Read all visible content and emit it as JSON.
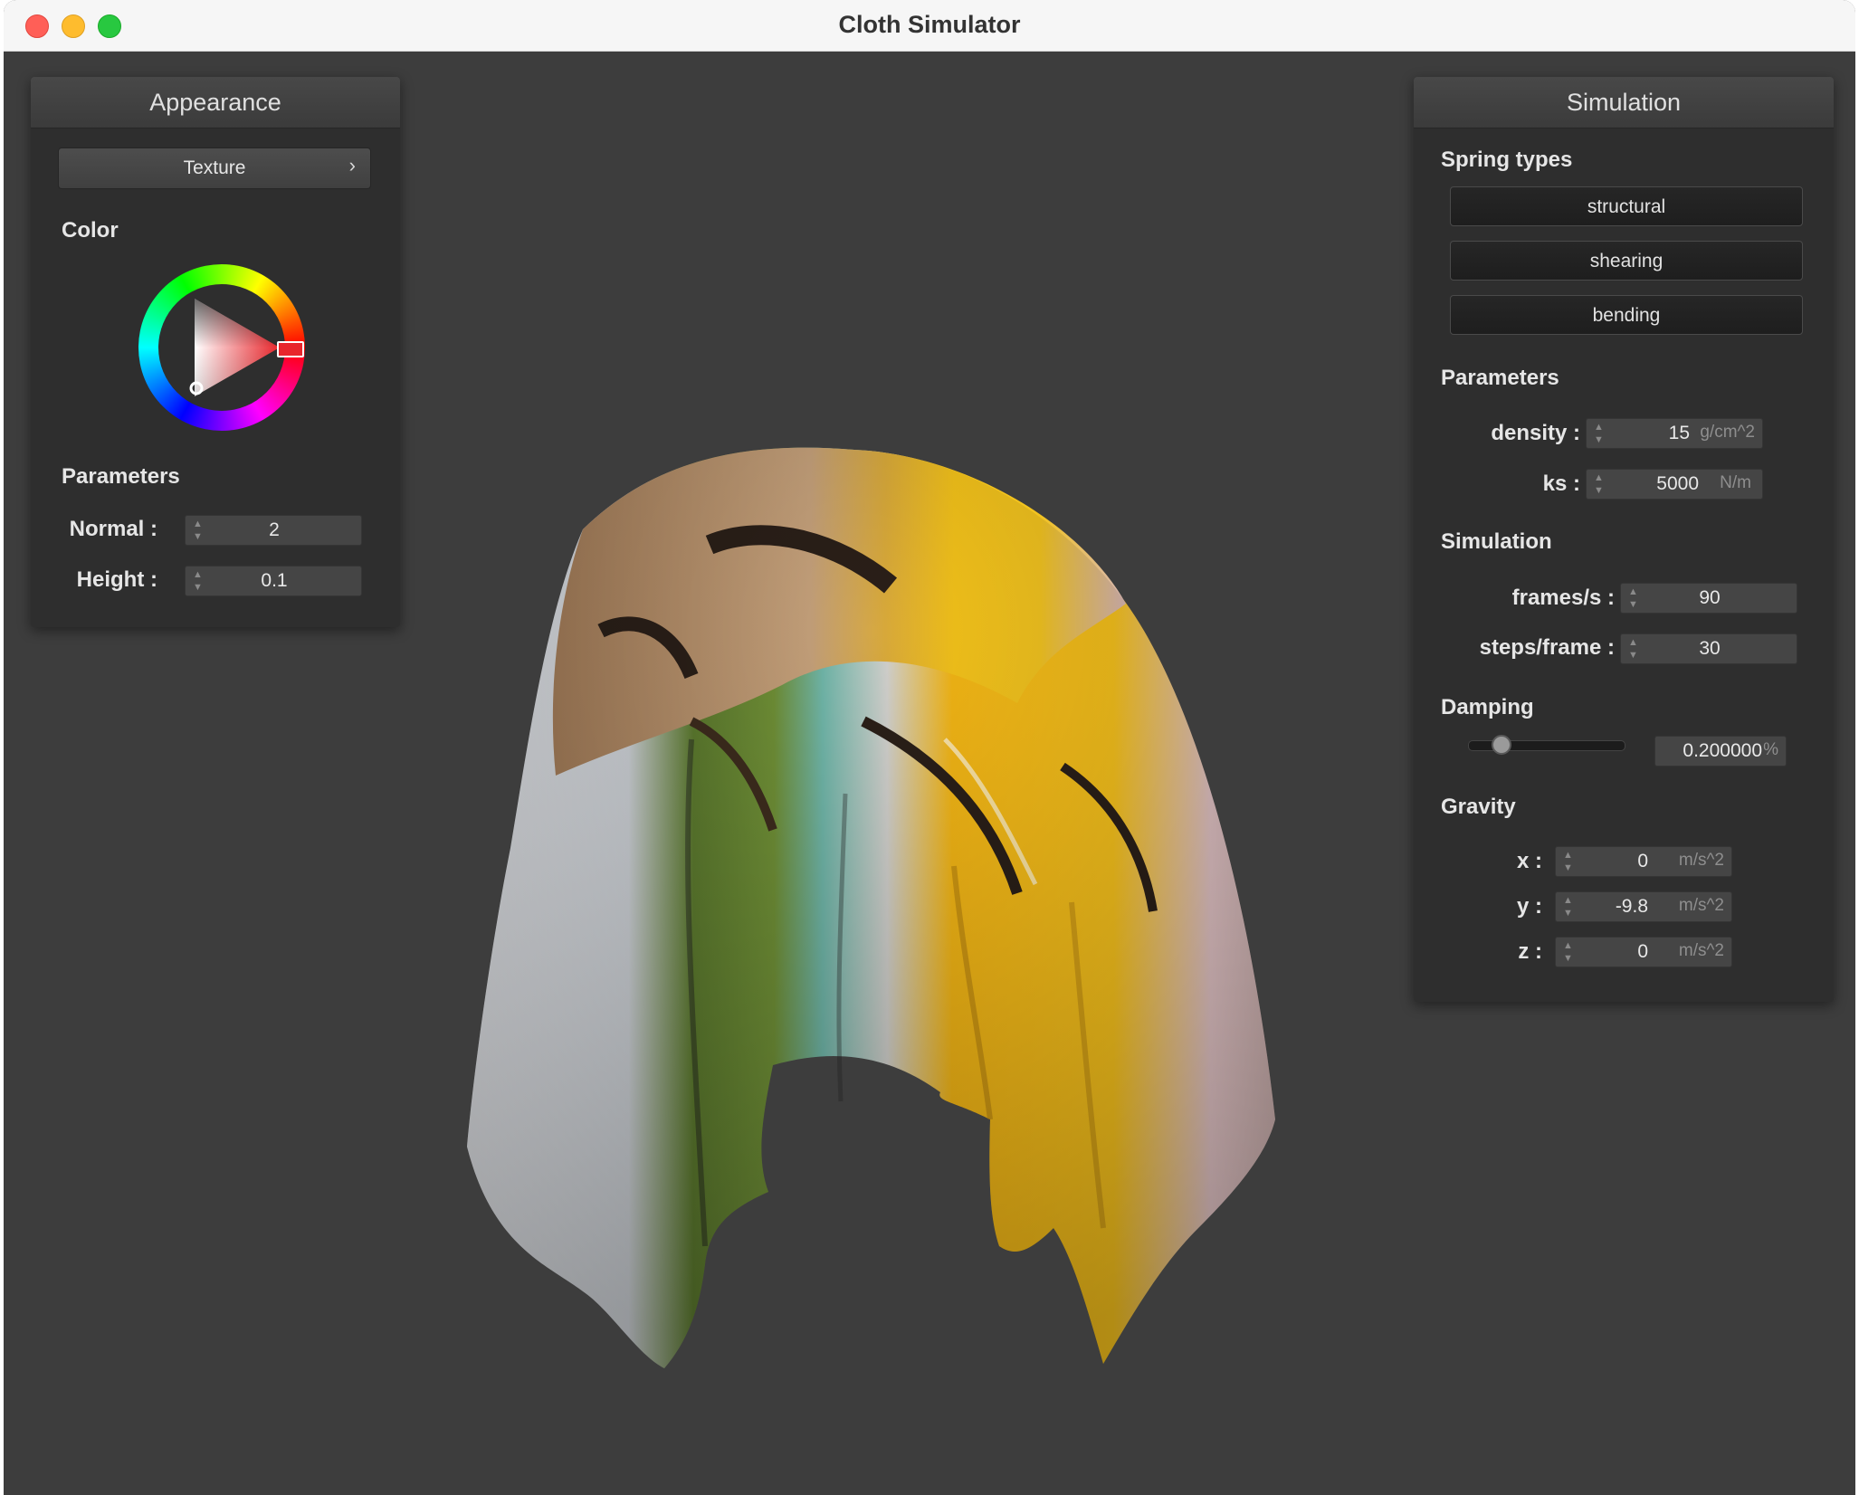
{
  "window": {
    "title": "Cloth Simulator"
  },
  "appearance": {
    "header": "Appearance",
    "texture_button": "Texture",
    "texture_chevron": "›",
    "color_label": "Color",
    "selected_color": "#e8252b",
    "params_label": "Parameters",
    "normal": {
      "label": "Normal :",
      "value": "2"
    },
    "height": {
      "label": "Height :",
      "value": "0.1"
    }
  },
  "simulation_panel": {
    "header": "Simulation",
    "spring_types_label": "Spring types",
    "springs": [
      "structural",
      "shearing",
      "bending"
    ],
    "params_label": "Parameters",
    "density": {
      "label": "density :",
      "value": "15",
      "unit": "g/cm^2"
    },
    "ks": {
      "label": "ks :",
      "value": "5000",
      "unit": "N/m"
    },
    "simulation_label": "Simulation",
    "fps": {
      "label": "frames/s :",
      "value": "90"
    },
    "steps": {
      "label": "steps/frame :",
      "value": "30"
    },
    "damping_label": "Damping",
    "damping": {
      "value": "0.200000",
      "unit": "%",
      "slider_fraction": 0.2
    },
    "gravity_label": "Gravity",
    "gravity": {
      "x": {
        "label": "x :",
        "value": "0",
        "unit": "m/s^2"
      },
      "y": {
        "label": "y :",
        "value": "-9.8",
        "unit": "m/s^2"
      },
      "z": {
        "label": "z :",
        "value": "0",
        "unit": "m/s^2"
      }
    }
  }
}
